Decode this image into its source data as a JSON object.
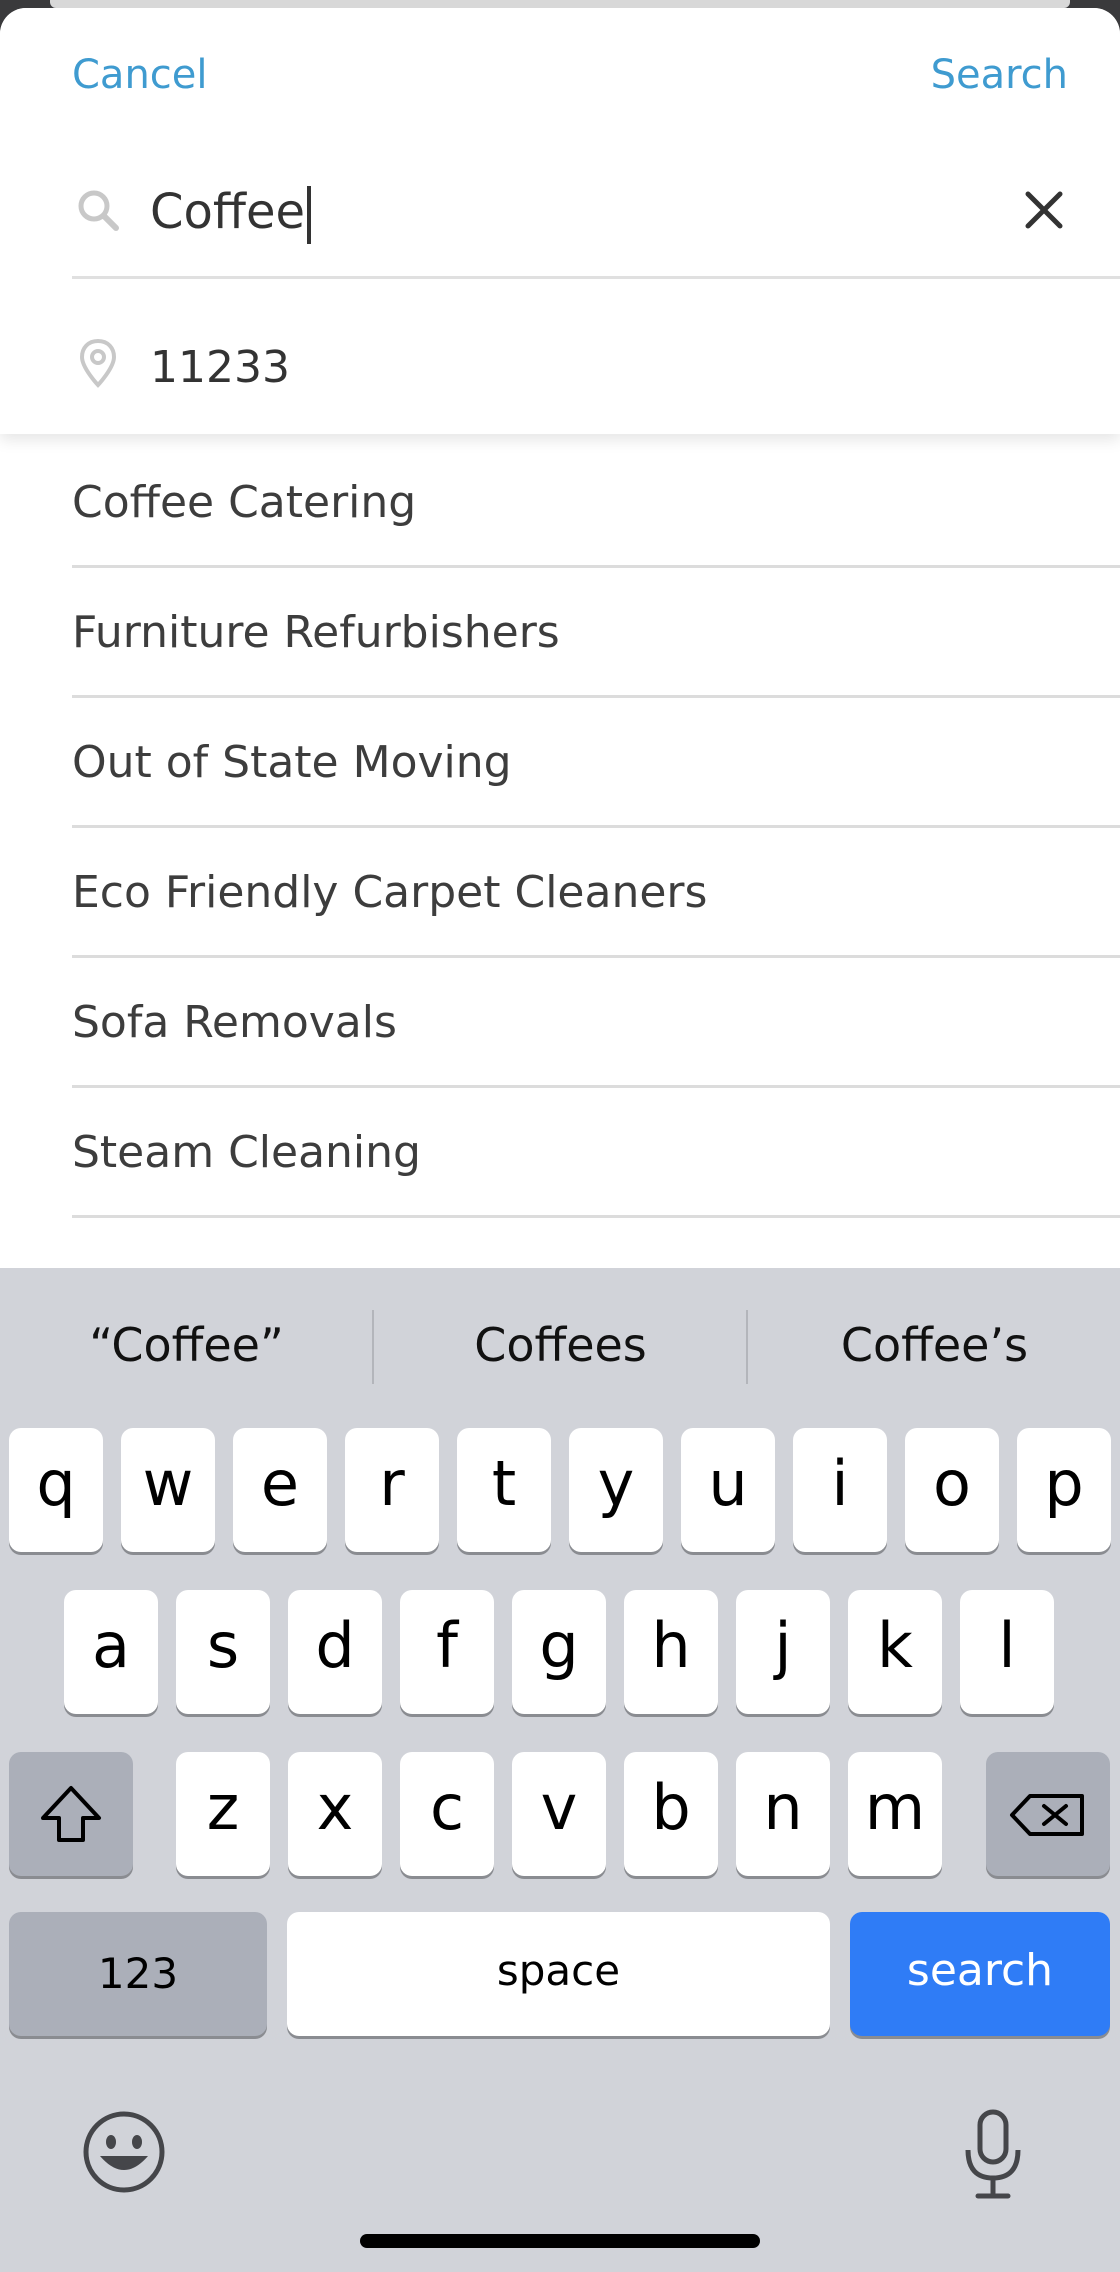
{
  "header": {
    "cancel_label": "Cancel",
    "search_label": "Search"
  },
  "search": {
    "query": "Coffee",
    "icon": "search-icon",
    "clear_icon": "close-icon"
  },
  "location": {
    "value": "11233",
    "icon": "location-pin-icon"
  },
  "results": [
    "Coffee Catering",
    "Furniture Refurbishers",
    "Out of State Moving",
    "Eco Friendly Carpet Cleaners",
    "Sofa Removals",
    "Steam Cleaning"
  ],
  "keyboard": {
    "suggestions": [
      "“Coffee”",
      "Coffees",
      "Coffee’s"
    ],
    "row1": [
      "q",
      "w",
      "e",
      "r",
      "t",
      "y",
      "u",
      "i",
      "o",
      "p"
    ],
    "row2": [
      "a",
      "s",
      "d",
      "f",
      "g",
      "h",
      "j",
      "k",
      "l"
    ],
    "row3": [
      "z",
      "x",
      "c",
      "v",
      "b",
      "n",
      "m"
    ],
    "numbers_label": "123",
    "space_label": "space",
    "action_label": "search",
    "shift_icon": "shift-icon",
    "delete_icon": "backspace-icon",
    "emoji_icon": "emoji-icon",
    "mic_icon": "microphone-icon"
  },
  "colors": {
    "accent": "#3f9bd0",
    "action_key": "#2f7cf6",
    "keyboard_bg": "#d1d3d9"
  }
}
